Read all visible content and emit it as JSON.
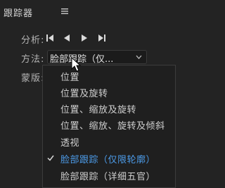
{
  "panel": {
    "title": "跟踪器",
    "menu_icon": "hamburger-menu-icon"
  },
  "analyze": {
    "label": "分析:",
    "controls": [
      {
        "name": "track-backward-one-frame-button",
        "icon": "step-back-icon"
      },
      {
        "name": "track-backward-button",
        "icon": "play-reverse-icon"
      },
      {
        "name": "track-forward-button",
        "icon": "play-icon"
      },
      {
        "name": "track-forward-one-frame-button",
        "icon": "step-forward-icon"
      }
    ]
  },
  "method": {
    "label": "方法:",
    "selected_value": "脸部跟踪（仅...",
    "chevron_icon": "chevron-down-icon"
  },
  "mask": {
    "label": "蒙版:"
  },
  "dropdown": {
    "items": [
      {
        "label": "位置",
        "selected": false
      },
      {
        "label": "位置及旋转",
        "selected": false
      },
      {
        "label": "位置、缩放及旋转",
        "selected": false
      },
      {
        "label": "位置、缩放、旋转及倾斜",
        "selected": false
      },
      {
        "label": "透视",
        "selected": false
      },
      {
        "label": "脸部跟踪（仅限轮廓）",
        "selected": true
      },
      {
        "label": "脸部跟踪（详细五官）",
        "selected": false
      }
    ]
  },
  "colors": {
    "background": "#232323",
    "text": "#c8c8c8",
    "selected_accent": "#4c9be8"
  }
}
